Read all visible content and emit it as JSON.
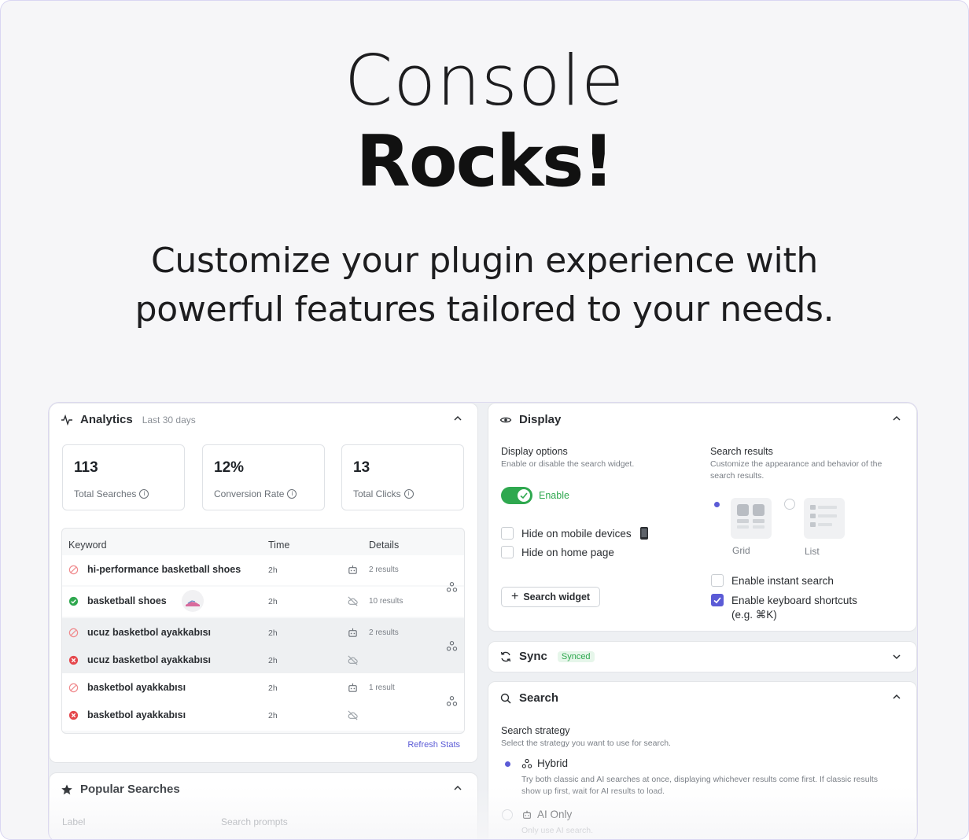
{
  "hero": {
    "title_light": "Console",
    "title_bold": "Rocks!",
    "subtitle_line1": "Customize your plugin experience with",
    "subtitle_line2": "powerful features tailored to your needs."
  },
  "analytics": {
    "title": "Analytics",
    "period": "Last 30 days",
    "stats": [
      {
        "value": "113",
        "label": "Total Searches"
      },
      {
        "value": "12%",
        "label": "Conversion Rate"
      },
      {
        "value": "13",
        "label": "Total Clicks"
      }
    ],
    "columns": [
      "Keyword",
      "Time",
      "Details"
    ],
    "rows": [
      {
        "keyword": "hi-performance basketball shoes",
        "time": "2h",
        "details": "2 results",
        "status": "no-click",
        "source": "robot"
      },
      {
        "keyword": "basketball shoes",
        "time": "2h",
        "details": "10 results",
        "status": "success",
        "source": "cloud-off"
      },
      {
        "keyword": "ucuz basketbol ayakkabısı",
        "time": "2h",
        "details": "2 results",
        "status": "no-click",
        "source": "robot"
      },
      {
        "keyword": "ucuz basketbol ayakkabısı",
        "time": "2h",
        "details": "",
        "status": "error",
        "source": "cloud-off"
      },
      {
        "keyword": "basketbol ayakkabısı",
        "time": "2h",
        "details": "1 result",
        "status": "no-click",
        "source": "robot"
      },
      {
        "keyword": "basketbol ayakkabısı",
        "time": "2h",
        "details": "",
        "status": "error",
        "source": "cloud-off"
      }
    ],
    "refresh_label": "Refresh Stats"
  },
  "popular": {
    "title": "Popular Searches",
    "col_label": "Label",
    "col_prompts": "Search prompts"
  },
  "display": {
    "title": "Display",
    "options_title": "Display options",
    "options_desc": "Enable or disable the search widget.",
    "enable_label": "Enable",
    "hide_mobile": "Hide on mobile devices",
    "hide_home": "Hide on home page",
    "search_widget_button": "Search widget",
    "results_title": "Search results",
    "results_desc_1": "Customize the appearance and behavior of the",
    "results_desc_2": "search results.",
    "grid_label": "Grid",
    "list_label": "List",
    "instant_search": "Enable instant search",
    "keyboard_shortcuts": "Enable keyboard shortcuts",
    "shortcut_hint": "(e.g. ⌘K)"
  },
  "sync": {
    "title": "Sync",
    "badge": "Synced"
  },
  "search": {
    "title": "Search",
    "strategy_title": "Search strategy",
    "strategy_desc": "Select the strategy you want to use for search.",
    "hybrid_label": "Hybrid",
    "hybrid_desc_1": "Try both classic and AI searches at once, displaying whichever results come first. If classic results",
    "hybrid_desc_2": "show up first, wait for AI results to load.",
    "ai_only_label": "AI Only",
    "ai_only_desc": "Only use AI search."
  },
  "colors": {
    "accent": "#5b5bd6",
    "success": "#2fa84f",
    "error": "#e5484d"
  }
}
